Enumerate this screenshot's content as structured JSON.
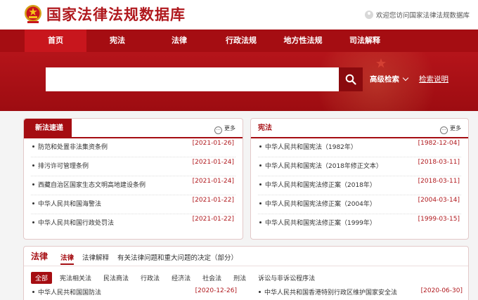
{
  "header": {
    "title": "国家法律法规数据库",
    "welcome": "欢迎您访问国家法律法规数据库"
  },
  "nav": [
    {
      "label": "首页"
    },
    {
      "label": "宪法"
    },
    {
      "label": "法律"
    },
    {
      "label": "行政法规"
    },
    {
      "label": "地方性法规"
    },
    {
      "label": "司法解释"
    }
  ],
  "search": {
    "value": "",
    "placeholder": "",
    "advanced": "高级检索",
    "help": "检索说明"
  },
  "new_laws": {
    "title": "新法速递",
    "more": "更多",
    "items": [
      {
        "title": "防范和处置非法集资条例",
        "date": "[2021-01-26]"
      },
      {
        "title": "排污许可管理条例",
        "date": "[2021-01-24]"
      },
      {
        "title": "西藏自治区国家生态文明高地建设条例",
        "date": "[2021-01-24]"
      },
      {
        "title": "中华人民共和国海警法",
        "date": "[2021-01-22]"
      },
      {
        "title": "中华人民共和国行政处罚法",
        "date": "[2021-01-22]"
      }
    ]
  },
  "constitution": {
    "title": "宪法",
    "more": "更多",
    "items": [
      {
        "title": "中华人民共和国宪法（1982年）",
        "date": "[1982-12-04]"
      },
      {
        "title": "中华人民共和国宪法（2018年修正文本）",
        "date": "[2018-03-11]"
      },
      {
        "title": "中华人民共和国宪法修正案（2018年）",
        "date": "[2018-03-11]"
      },
      {
        "title": "中华人民共和国宪法修正案（2004年）",
        "date": "[2004-03-14]"
      },
      {
        "title": "中华人民共和国宪法修正案（1999年）",
        "date": "[1999-03-15]"
      }
    ]
  },
  "laws": {
    "title": "法律",
    "tabs": [
      "法律",
      "法律解释",
      "有关法律问题和重大问题的决定（部分）"
    ],
    "categories": [
      "全部",
      "宪法相关法",
      "民法商法",
      "行政法",
      "经济法",
      "社会法",
      "刑法",
      "诉讼与非诉讼程序法"
    ],
    "rows": [
      {
        "title": "中华人民共和国国防法",
        "date": "[2020-12-26]"
      },
      {
        "title": "中华人民共和国香港特别行政区维护国家安全法",
        "date": "[2020-06-30]"
      }
    ]
  },
  "colors": {
    "brand_red": "#a50d12",
    "active_tab": "#c8161d"
  }
}
